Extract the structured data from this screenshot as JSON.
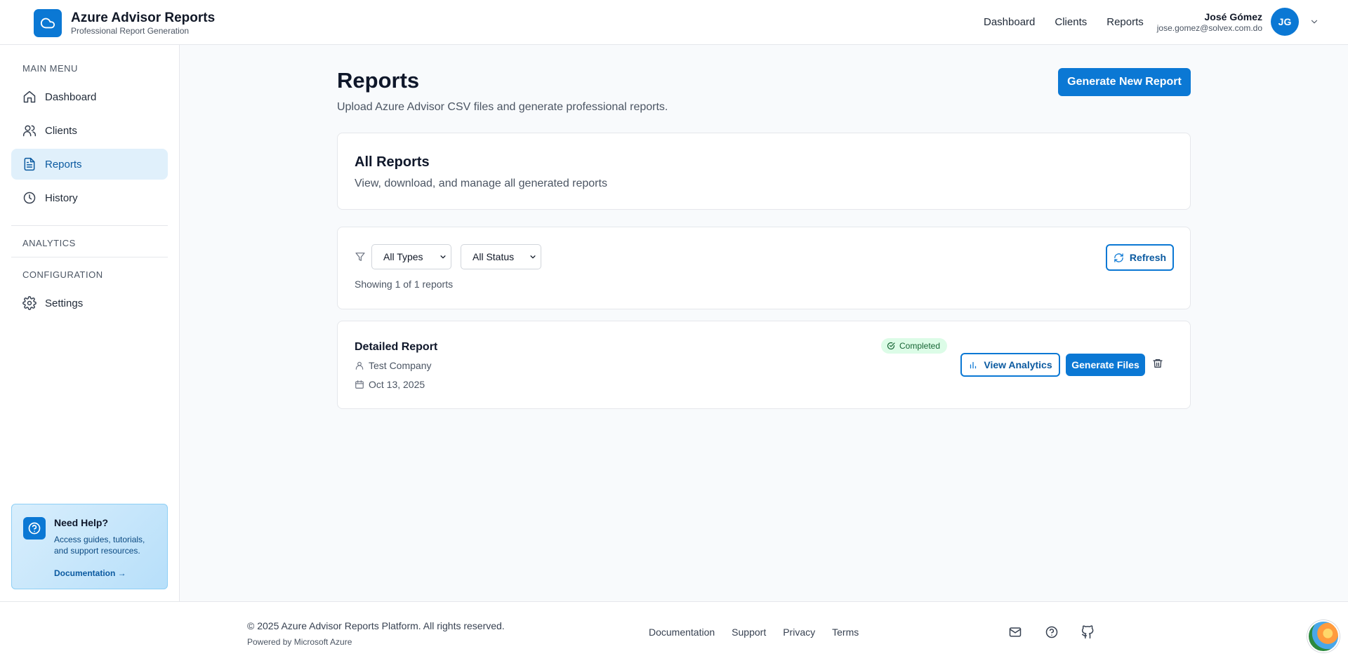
{
  "header": {
    "app_title": "Azure Advisor Reports",
    "app_subtitle": "Professional Report Generation",
    "nav": [
      "Dashboard",
      "Clients",
      "Reports"
    ],
    "user_name": "José Gómez",
    "user_email": "jose.gomez@solvex.com.do",
    "user_initials": "JG"
  },
  "sidebar": {
    "main_menu_label": "MAIN MENU",
    "items": [
      {
        "label": "Dashboard",
        "icon": "home-icon"
      },
      {
        "label": "Clients",
        "icon": "users-icon"
      },
      {
        "label": "Reports",
        "icon": "document-icon",
        "active": true
      },
      {
        "label": "History",
        "icon": "clock-icon"
      }
    ],
    "analytics_label": "ANALYTICS",
    "configuration_label": "CONFIGURATION",
    "settings_label": "Settings",
    "help": {
      "title": "Need Help?",
      "description": "Access guides, tutorials, and support resources.",
      "link": "Documentation →"
    }
  },
  "main": {
    "title": "Reports",
    "subtitle": "Upload Azure Advisor CSV files and generate professional reports.",
    "generate_button": "Generate New Report",
    "all_reports": {
      "title": "All Reports",
      "subtitle": "View, download, and manage all generated reports"
    },
    "filters": {
      "type_value": "All Types",
      "status_value": "All Status",
      "refresh_label": "Refresh",
      "showing_text": "Showing 1 of 1 reports"
    },
    "reports": [
      {
        "title": "Detailed Report",
        "client": "Test Company",
        "date": "Oct 13, 2025",
        "status": "Completed",
        "view_analytics_label": "View Analytics",
        "generate_files_label": "Generate Files"
      }
    ]
  },
  "footer": {
    "copyright": "© 2025 Azure Advisor Reports Platform. All rights reserved.",
    "powered": "Powered by Microsoft Azure",
    "links": [
      "Documentation",
      "Support",
      "Privacy",
      "Terms"
    ]
  },
  "colors": {
    "primary": "#0b78d4",
    "active_bg": "#e0f0fb",
    "success_bg": "#dcfce7",
    "success_text": "#166534"
  }
}
